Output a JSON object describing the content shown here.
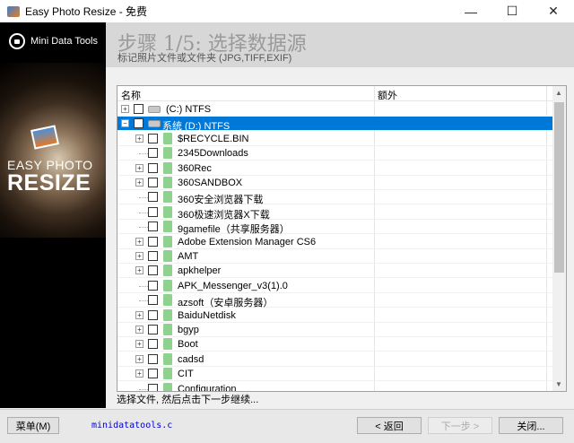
{
  "window": {
    "title": "Easy Photo Resize - 免费",
    "min": "—",
    "max": "☐",
    "close": "✕"
  },
  "sidebar": {
    "brand": "Mini Data Tools",
    "logo_line1": "EASY PHOTO",
    "logo_line2": "RESIZE"
  },
  "header": {
    "step": "步骤 1/5: 选择数据源",
    "subtitle": "标记照片文件或文件夹  (JPG,TIFF,EXIF)"
  },
  "tree": {
    "columns": [
      "名称",
      "额外"
    ],
    "rows": [
      {
        "label": "(C:) NTFS",
        "level": 0,
        "expander": true,
        "type": "drive",
        "selected": false
      },
      {
        "label": "系统 (D:) NTFS",
        "level": 0,
        "expander": true,
        "expanded": true,
        "type": "drive",
        "selected": true
      },
      {
        "label": "$RECYCLE.BIN",
        "level": 1,
        "expander": true,
        "type": "folder"
      },
      {
        "label": "2345Downloads",
        "level": 1,
        "expander": false,
        "type": "folder"
      },
      {
        "label": "360Rec",
        "level": 1,
        "expander": true,
        "type": "folder"
      },
      {
        "label": "360SANDBOX",
        "level": 1,
        "expander": true,
        "type": "folder"
      },
      {
        "label": "360安全浏览器下载",
        "level": 1,
        "expander": false,
        "type": "folder"
      },
      {
        "label": "360极速浏览器X下载",
        "level": 1,
        "expander": false,
        "type": "folder"
      },
      {
        "label": "9gamefile（共享服务器）",
        "level": 1,
        "expander": false,
        "type": "folder"
      },
      {
        "label": "Adobe Extension Manager CS6",
        "level": 1,
        "expander": true,
        "type": "folder"
      },
      {
        "label": "AMT",
        "level": 1,
        "expander": true,
        "type": "folder"
      },
      {
        "label": "apkhelper",
        "level": 1,
        "expander": true,
        "type": "folder"
      },
      {
        "label": "APK_Messenger_v3(1).0",
        "level": 1,
        "expander": false,
        "type": "folder"
      },
      {
        "label": "azsoft（安卓服务器）",
        "level": 1,
        "expander": false,
        "type": "folder"
      },
      {
        "label": "BaiduNetdisk",
        "level": 1,
        "expander": true,
        "type": "folder"
      },
      {
        "label": "bgyp",
        "level": 1,
        "expander": true,
        "type": "folder"
      },
      {
        "label": "Boot",
        "level": 1,
        "expander": true,
        "type": "folder"
      },
      {
        "label": "cadsd",
        "level": 1,
        "expander": true,
        "type": "folder"
      },
      {
        "label": "CIT",
        "level": 1,
        "expander": true,
        "type": "folder"
      },
      {
        "label": "Configuration",
        "level": 1,
        "expander": false,
        "type": "folder"
      }
    ]
  },
  "status": "选择文件, 然后点击下一步继续...",
  "footer": {
    "menu": "菜单(M)",
    "link": "minidatatools.c",
    "back": "< 返回",
    "next": "下一步 >",
    "close": "关闭..."
  }
}
